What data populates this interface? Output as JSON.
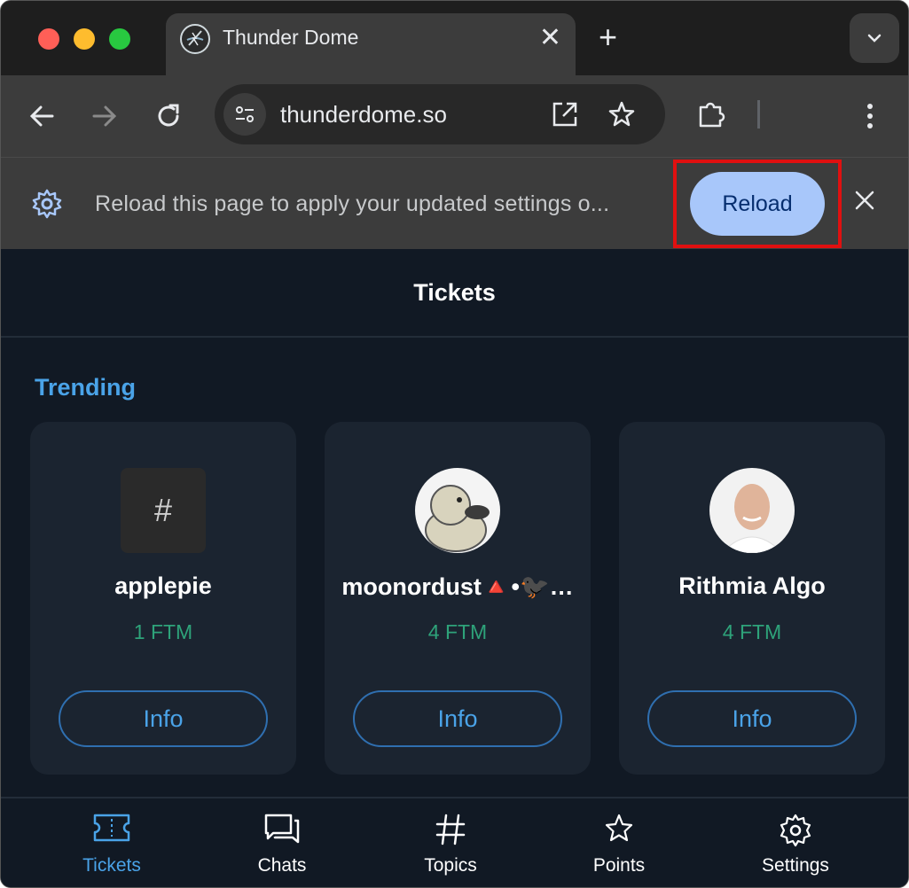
{
  "browser": {
    "tab": {
      "title": "Thunder Dome",
      "favicon": "thunderdome-logo-icon"
    },
    "url": "thunderdome.so",
    "infobar": {
      "message": "Reload this page to apply your updated settings o...",
      "button_label": "Reload"
    }
  },
  "page": {
    "title": "Tickets",
    "section_title": "Trending",
    "cards": [
      {
        "name": "applepie",
        "price": "1 FTM",
        "button": "Info",
        "avatar": "hash-icon"
      },
      {
        "name": "moonordust🔺•🐦‍⬛…",
        "price": "4 FTM",
        "button": "Info",
        "avatar": "duck-avatar"
      },
      {
        "name": "Rithmia Algo",
        "price": "4 FTM",
        "button": "Info",
        "avatar": "person-avatar"
      }
    ],
    "hash_symbol": "#"
  },
  "bottom_nav": [
    {
      "label": "Tickets",
      "icon": "ticket-icon",
      "active": true
    },
    {
      "label": "Chats",
      "icon": "chat-icon",
      "active": false
    },
    {
      "label": "Topics",
      "icon": "hash-icon",
      "active": false
    },
    {
      "label": "Points",
      "icon": "star-icon",
      "active": false
    },
    {
      "label": "Settings",
      "icon": "gear-icon",
      "active": false
    }
  ],
  "colors": {
    "accent": "#4aa3e8",
    "price": "#2ea37a",
    "reload_button": "#a8c7fa",
    "highlight": "#e01010",
    "page_bg": "#111924",
    "card_bg": "#1b2430"
  }
}
